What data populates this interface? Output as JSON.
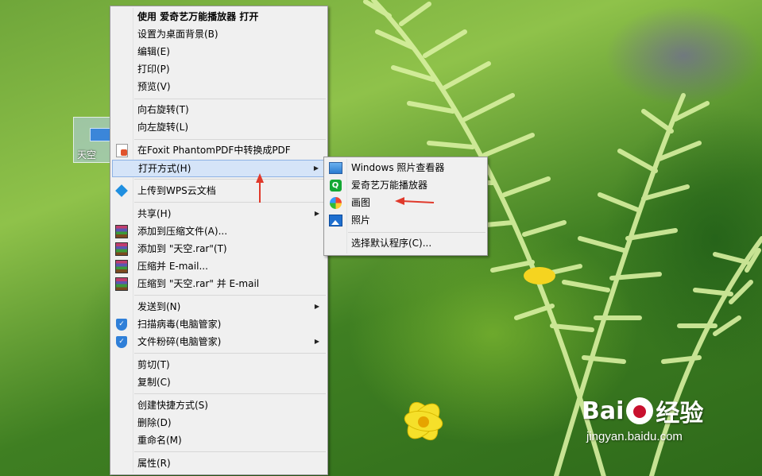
{
  "desktop": {
    "icon_label": "天空"
  },
  "context_menu": {
    "open_with_app": "使用 爱奇艺万能播放器 打开",
    "set_wallpaper": "设置为桌面背景(B)",
    "edit": "编辑(E)",
    "print": "打印(P)",
    "preview": "预览(V)",
    "rotate_right": "向右旋转(T)",
    "rotate_left": "向左旋转(L)",
    "foxit_convert": "在Foxit PhantomPDF中转换成PDF",
    "open_with": "打开方式(H)",
    "upload_wps": "上传到WPS云文档",
    "share": "共享(H)",
    "add_archive": "添加到压缩文件(A)...",
    "add_to_rar": "添加到 \"天空.rar\"(T)",
    "compress_email": "压缩并 E-mail...",
    "compress_rar_email": "压缩到 \"天空.rar\" 并 E-mail",
    "send_to": "发送到(N)",
    "scan_virus": "扫描病毒(电脑管家)",
    "shred_file": "文件粉碎(电脑管家)",
    "cut": "剪切(T)",
    "copy": "复制(C)",
    "create_shortcut": "创建快捷方式(S)",
    "delete": "删除(D)",
    "rename": "重命名(M)",
    "properties": "属性(R)"
  },
  "submenu": {
    "items": [
      {
        "label": "Windows 照片查看器",
        "icon": "photo-viewer-icon"
      },
      {
        "label": "爱奇艺万能播放器",
        "icon": "iqiyi-icon"
      },
      {
        "label": "画图",
        "icon": "paint-icon"
      },
      {
        "label": "照片",
        "icon": "photos-icon"
      }
    ],
    "choose_default": "选择默认程序(C)..."
  },
  "watermark": {
    "brand": "Bai",
    "brand_suffix": "经验",
    "url": "jingyan.baidu.com"
  },
  "colors": {
    "highlight": "#d5e4f8",
    "annotation_arrow": "#e0392b",
    "menu_bg": "#f0f0f0"
  }
}
